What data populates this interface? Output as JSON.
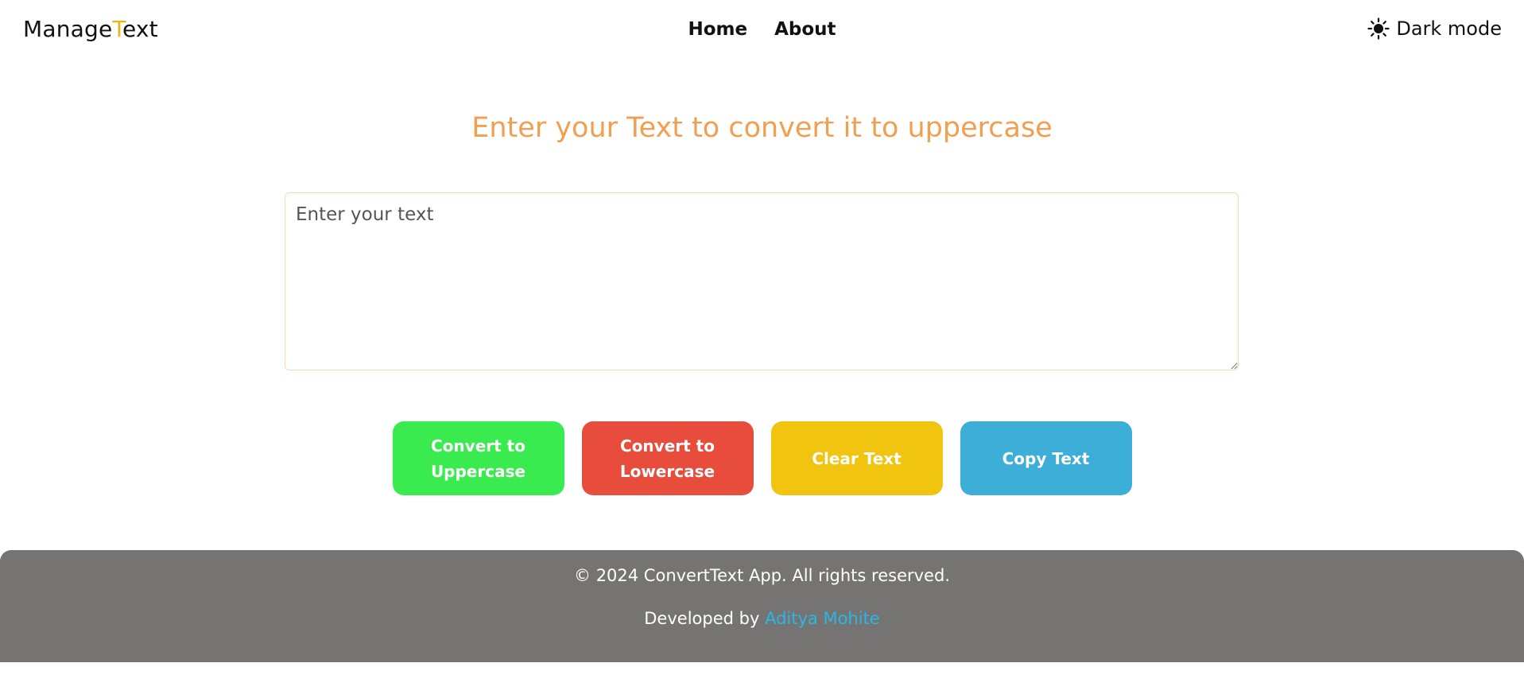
{
  "navbar": {
    "brand_prefix": "Manage",
    "brand_accent": "T",
    "brand_suffix": "ext",
    "links": [
      {
        "label": "Home"
      },
      {
        "label": "About"
      }
    ],
    "darkmode_label": "Dark mode",
    "darkmode_icon": "sun-icon"
  },
  "main": {
    "heading": "Enter your Text to convert it to uppercase",
    "textarea_placeholder": "Enter your text",
    "textarea_value": "",
    "buttons": {
      "uppercase": "Convert to Uppercase",
      "lowercase": "Convert to Lowercase",
      "clear": "Clear Text",
      "copy": "Copy Text"
    }
  },
  "footer": {
    "copyright": "© 2024 ConvertText App. All rights reserved.",
    "developed_by": "Developed by",
    "developer_name": "Aditya Mohite"
  },
  "colors": {
    "heading": "#f0a050",
    "brand_accent": "#e8b513",
    "btn_uppercase": "#3aeb4f",
    "btn_lowercase": "#e84c3d",
    "btn_clear": "#f1c40f",
    "btn_copy": "#3daed8",
    "footer_bg": "#757473",
    "footer_link": "#27b8e8"
  }
}
